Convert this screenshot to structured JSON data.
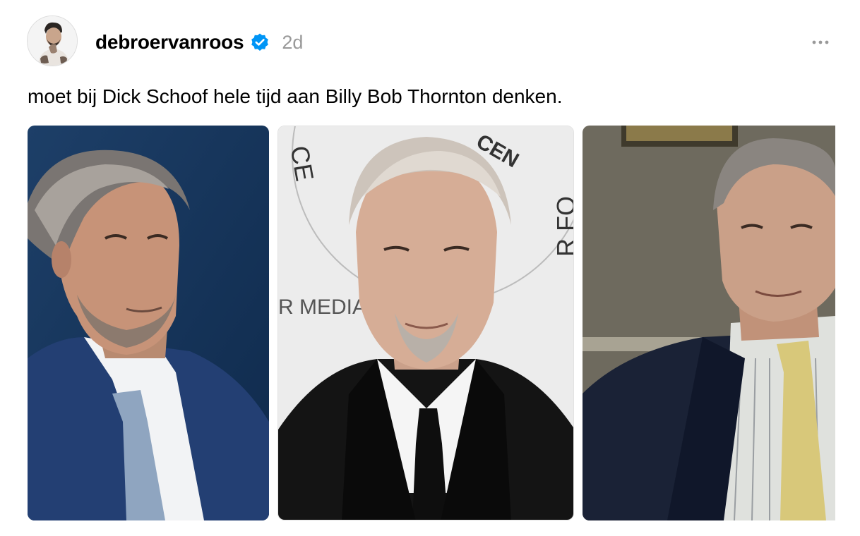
{
  "post": {
    "author": {
      "username": "debroervanroos",
      "verified": true,
      "avatar_icon": "profile-photo"
    },
    "timestamp": "2d",
    "more_icon": "ellipsis-icon",
    "text": "moet bij Dick Schoof hele tijd aan Billy Bob Thornton denken.",
    "media": [
      {
        "description_icon": "photo-man-grey-hair-blue-suit"
      },
      {
        "description_icon": "photo-man-black-suit-paley-backdrop",
        "backdrop_text": "R MEDIA"
      },
      {
        "description_icon": "photo-man-navy-suit-yellow-tie"
      }
    ],
    "colors": {
      "verified_blue": "#0095f6",
      "timestamp_grey": "#999999"
    }
  }
}
